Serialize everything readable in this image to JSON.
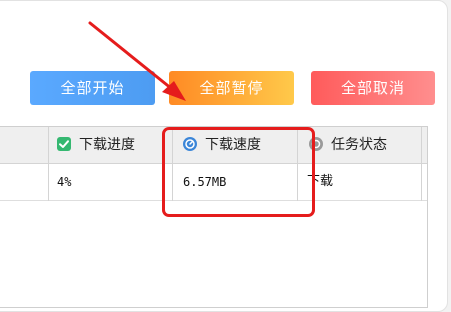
{
  "toolbar": {
    "start_all": "全部开始",
    "pause_all": "全部暂停",
    "cancel_all": "全部取消"
  },
  "table": {
    "headers": {
      "progress": "下载进度",
      "speed": "下载速度",
      "status": "任务状态"
    },
    "rows": [
      {
        "progress": "4%",
        "speed": "6.57MB",
        "status": "下载"
      }
    ]
  },
  "colors": {
    "start_button": "#5aa9ff",
    "pause_button": "#ff8a24",
    "cancel_button": "#ff5b5b",
    "annotation": "#e51c1c",
    "progress_icon": "#35b871",
    "speed_icon": "#3b86d8",
    "status_icon": "#9a9a9a"
  },
  "icons": {
    "progress": "checkmark-icon",
    "speed": "speed-gauge-icon",
    "status": "status-info-icon"
  }
}
